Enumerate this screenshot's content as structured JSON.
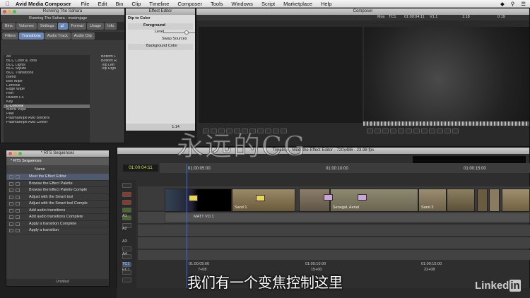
{
  "menubar": {
    "app": "Avid Media Composer",
    "items": [
      "File",
      "Edit",
      "Bin",
      "Clip",
      "Timeline",
      "Composer",
      "Tools",
      "Windows",
      "Script",
      "Marketplace",
      "Help"
    ]
  },
  "project": {
    "title": "Running The Sahara",
    "bin_title": "Running The Sahara - maximjage",
    "tabs1": [
      "Bins",
      "Volumes",
      "Settings",
      "",
      "Format",
      "Usage",
      "Info"
    ],
    "tabs2": [
      "Filters",
      "Transitions",
      "Audio Track",
      "Audio Clip"
    ],
    "categories": [
      "All",
      "BCC Color & Tone",
      "BCC Lights",
      "BCC Stylize",
      "BCC Transitions",
      "Blend",
      "Box Wipe",
      "Conceal",
      "Edge Wipe",
      "Film",
      "Illusion FX",
      "Key",
      "L-Conceal",
      "Matrix Wipe",
      "Peel",
      "PlasmaWipe Avid Borders",
      "PlasmaWipe Avid Center"
    ],
    "effects": [
      "Bottom L",
      "Bottom R",
      "Top Left",
      "Top Righ"
    ]
  },
  "effect_editor": {
    "title": "Effect Editor",
    "effect": "Dip to Color",
    "foreground": "Foreground",
    "level": "Level",
    "swap": "Swap Sources",
    "background": "Background Color",
    "frames": "1:14"
  },
  "composer": {
    "title": "Composer",
    "mos": "Mos",
    "tc1": "TC1",
    "timecode": "01:00:04:11",
    "v": "V1.1",
    "dur": "1:18",
    "dur2": "0:19"
  },
  "sequences": {
    "title": "* RTS Sequences",
    "tab": "* RTS Sequences",
    "col": "Name",
    "items": [
      "Meet the Effect Editor",
      "Browse the Effect Palette",
      "Browse the Effect Palette Comple",
      "Adjust with the Smart tool",
      "Adjust with the Smart tool Comple",
      "Add audio transitions",
      "Add audio transitions Complete",
      "Apply a transition Complete",
      "Apply a transition"
    ],
    "footer": "Untitled"
  },
  "timeline": {
    "title": "Timeline - Meet the Effect Editor - 720x486 - 23.98 fps",
    "tc": "01:00:04:11",
    "ruler": [
      "01:00:05:00",
      "01:00:10:00",
      "01:00:15:00"
    ],
    "tracks": [
      "V1",
      "A1",
      "A2",
      "A3",
      "A4",
      "TC1",
      "EC1"
    ],
    "clip_labels": [
      "Sand 1",
      "Senegal, Aerial",
      "Sand 3"
    ],
    "matt": "MATT VO 1",
    "tc_row": [
      "01:00:05:00",
      "01:00:10:00",
      "01:00:15:00"
    ],
    "ec_row": [
      "7+08",
      "15+00",
      "22+08"
    ]
  },
  "subtitle": "我们有一个变焦控制这里",
  "watermark": "永远的CG",
  "brand": "Linked in"
}
